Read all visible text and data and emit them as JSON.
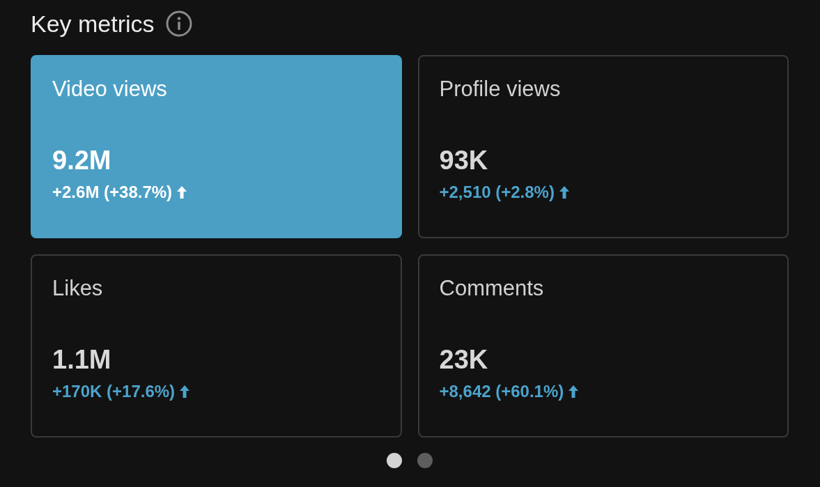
{
  "header": {
    "title": "Key metrics"
  },
  "metrics": [
    {
      "label": "Video views",
      "value": "9.2M",
      "change": "+2.6M (+38.7%)",
      "rising": true,
      "selected": true
    },
    {
      "label": "Profile views",
      "value": "93K",
      "change": "+2,510 (+2.8%)",
      "rising": true,
      "selected": false
    },
    {
      "label": "Likes",
      "value": "1.1M",
      "change": "+170K (+17.6%)",
      "rising": true,
      "selected": false
    },
    {
      "label": "Comments",
      "value": "23K",
      "change": "+8,642 (+60.1%)",
      "rising": true,
      "selected": false
    }
  ],
  "pages": [
    {
      "selected": true
    },
    {
      "selected": false
    }
  ]
}
